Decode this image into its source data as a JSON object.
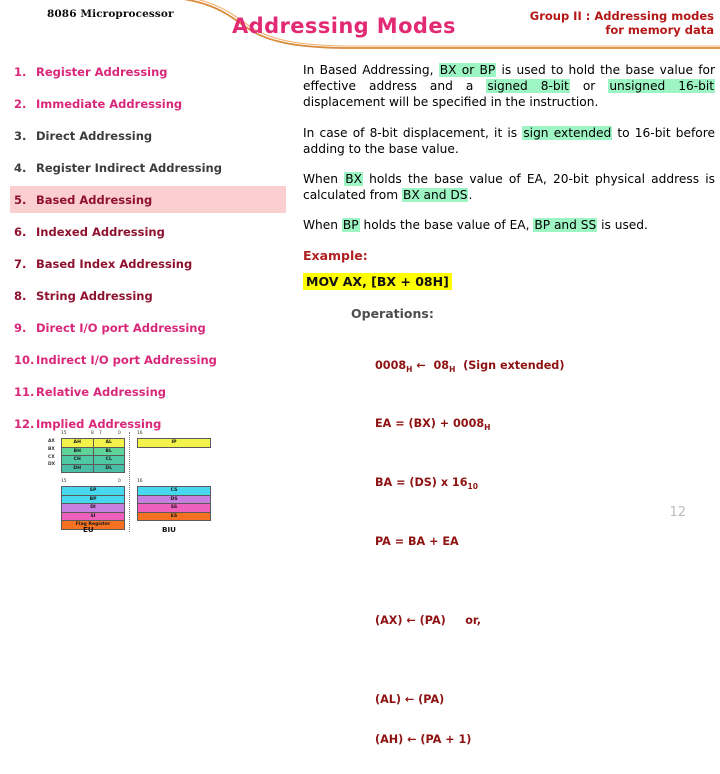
{
  "header": {
    "deck_label": "8086 Microprocessor",
    "slide_title": "Addressing Modes",
    "group_heading_line1": "Group II : Addressing modes",
    "group_heading_line2": "for memory data",
    "title_color": "#e22a74",
    "group_heading_color": "#b51717",
    "swoosh_color": "#d98a3d"
  },
  "modes": {
    "items": [
      {
        "num": "1.",
        "label": "Register Addressing",
        "style": "pink",
        "highlighted": false
      },
      {
        "num": "2.",
        "label": "Immediate Addressing",
        "style": "pink",
        "highlighted": false
      },
      {
        "num": "3.",
        "label": "Direct Addressing",
        "style": "dark",
        "highlighted": false
      },
      {
        "num": "4.",
        "label": "Register Indirect Addressing",
        "style": "dark",
        "highlighted": false
      },
      {
        "num": "5.",
        "label": "Based Addressing",
        "style": "maroon",
        "highlighted": true
      },
      {
        "num": "6.",
        "label": "Indexed Addressing",
        "style": "maroon",
        "highlighted": false
      },
      {
        "num": "7.",
        "label": "Based Index Addressing",
        "style": "maroon",
        "highlighted": false
      },
      {
        "num": "8.",
        "label": "String Addressing",
        "style": "maroon",
        "highlighted": false
      },
      {
        "num": "9.",
        "label": "Direct I/O port Addressing",
        "style": "pink",
        "highlighted": false
      },
      {
        "num": "10.",
        "label": "Indirect I/O port Addressing",
        "style": "pink",
        "highlighted": false
      },
      {
        "num": "11.",
        "label": "Relative Addressing",
        "style": "pink",
        "highlighted": false
      },
      {
        "num": "12.",
        "label": "Implied Addressing",
        "style": "pink",
        "highlighted": false
      }
    ],
    "highlight_color": "#fbcfcf"
  },
  "content": {
    "highlight_green": "#9ef5c4",
    "highlight_yellow": "#ffff00",
    "para1": {
      "t1": "In Based Addressing, ",
      "h1": "BX or BP",
      "t2": " is used to hold the base value for effective address and a ",
      "h2": "signed 8-bit",
      "t3": " or ",
      "h3": "unsigned 16-bit",
      "t4": " displacement will be specified in the instruction."
    },
    "para2": {
      "t1": "In case of 8-bit displacement, it is ",
      "h1": "sign extended",
      "t2": " to 16-bit before adding to the base value."
    },
    "para3": {
      "t1": "When ",
      "h1": "BX",
      "t2": " holds the base value of EA, 20-bit physical address is calculated from ",
      "h2": "BX and DS",
      "t3": "."
    },
    "para4": {
      "t1": "When ",
      "h1": "BP",
      "t2": " holds the base value of EA, ",
      "h2": "BP and SS",
      "t3": " is used."
    },
    "example_label": "Example:",
    "example_code": "MOV AX, [BX + 08H]",
    "operations_label": "Operations:",
    "operation_lines": [
      {
        "pre": "0008",
        "sub1": "H",
        "mid": " ←  08",
        "sub2": "H",
        "post": "  (Sign extended)"
      },
      {
        "pre": "EA = (BX) + 0008",
        "sub1": "H",
        "mid": "",
        "sub2": "",
        "post": ""
      },
      {
        "pre": "BA = (DS) x 16",
        "sub1": "10",
        "mid": "",
        "sub2": "",
        "post": ""
      },
      {
        "pre": "PA = BA + EA",
        "sub1": "",
        "mid": "",
        "sub2": "",
        "post": ""
      }
    ],
    "operation_lines_2": [
      {
        "pre": "(AX) ← (PA)     or,",
        "sub1": "",
        "mid": "",
        "sub2": "",
        "post": ""
      }
    ],
    "operation_lines_3": [
      {
        "pre": "(AL) ← (PA)",
        "sub1": "",
        "mid": "",
        "sub2": "",
        "post": ""
      },
      {
        "pre": "(AH) ← (PA + 1)",
        "sub1": "",
        "mid": "",
        "sub2": "",
        "post": ""
      }
    ]
  },
  "register_diagram": {
    "eu_label": "EU",
    "biu_label": "BIU",
    "general_registers": {
      "bit_high": "15",
      "bit_mid_left": "8",
      "bit_mid_right": "7",
      "bit_low": "0",
      "rows": [
        {
          "name": "AX",
          "high": "AH",
          "low": "AL",
          "color": "#f2f24a"
        },
        {
          "name": "BX",
          "high": "BH",
          "low": "BL",
          "color": "#5fd49a"
        },
        {
          "name": "CX",
          "high": "CH",
          "low": "CL",
          "color": "#4fc9a4"
        },
        {
          "name": "DX",
          "high": "DH",
          "low": "DL",
          "color": "#49bda6"
        }
      ]
    },
    "pointer_registers": {
      "bit_high": "15",
      "bit_low": "0",
      "rows": [
        {
          "name": "SP",
          "color": "#45d8ee"
        },
        {
          "name": "BP",
          "color": "#45d8ee"
        },
        {
          "name": "DI",
          "color": "#c77fe0"
        },
        {
          "name": "SI",
          "color": "#ef5fbd"
        },
        {
          "name": "Flag Register",
          "color": "#f57020"
        }
      ]
    },
    "instruction_queue": {
      "bit_high": "16",
      "bit_low": "0",
      "rows": [
        {
          "name": "IP",
          "color": "#f2f24a"
        }
      ]
    },
    "segment_registers": {
      "bit_high": "16",
      "bit_low": "0",
      "rows": [
        {
          "name": "CS",
          "color": "#45d8ee"
        },
        {
          "name": "DS",
          "color": "#c77fe0"
        },
        {
          "name": "SS",
          "color": "#ef5fbd"
        },
        {
          "name": "ES",
          "color": "#f57020"
        }
      ]
    }
  },
  "page_number": "12"
}
